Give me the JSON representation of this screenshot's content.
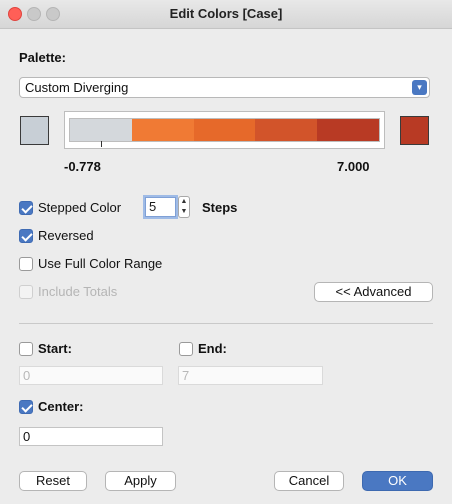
{
  "window": {
    "title": "Edit Colors [Case]"
  },
  "palette": {
    "label": "Palette:",
    "selected": "Custom Diverging"
  },
  "ramp": {
    "min_label": "-0.778",
    "max_label": "7.000",
    "start_color": "#c8cfd6",
    "end_color": "#b83a24",
    "segments": [
      "#d4d8dc",
      "#f07a34",
      "#e6692a",
      "#d2542a",
      "#b83a24"
    ]
  },
  "options": {
    "stepped_color": {
      "label": "Stepped Color",
      "checked": true
    },
    "steps": {
      "value": "5",
      "label": "Steps"
    },
    "reversed": {
      "label": "Reversed",
      "checked": true
    },
    "full_range": {
      "label": "Use Full Color Range",
      "checked": false
    },
    "include_totals": {
      "label": "Include Totals",
      "checked": false,
      "disabled": true
    },
    "advanced_label": "<< Advanced"
  },
  "advanced": {
    "start": {
      "label": "Start:",
      "checked": false,
      "value": "0"
    },
    "end": {
      "label": "End:",
      "checked": false,
      "value": "7"
    },
    "center": {
      "label": "Center:",
      "checked": true,
      "value": "0"
    }
  },
  "buttons": {
    "reset": "Reset",
    "apply": "Apply",
    "cancel": "Cancel",
    "ok": "OK"
  },
  "colors": {
    "accent": "#4a78c2"
  }
}
